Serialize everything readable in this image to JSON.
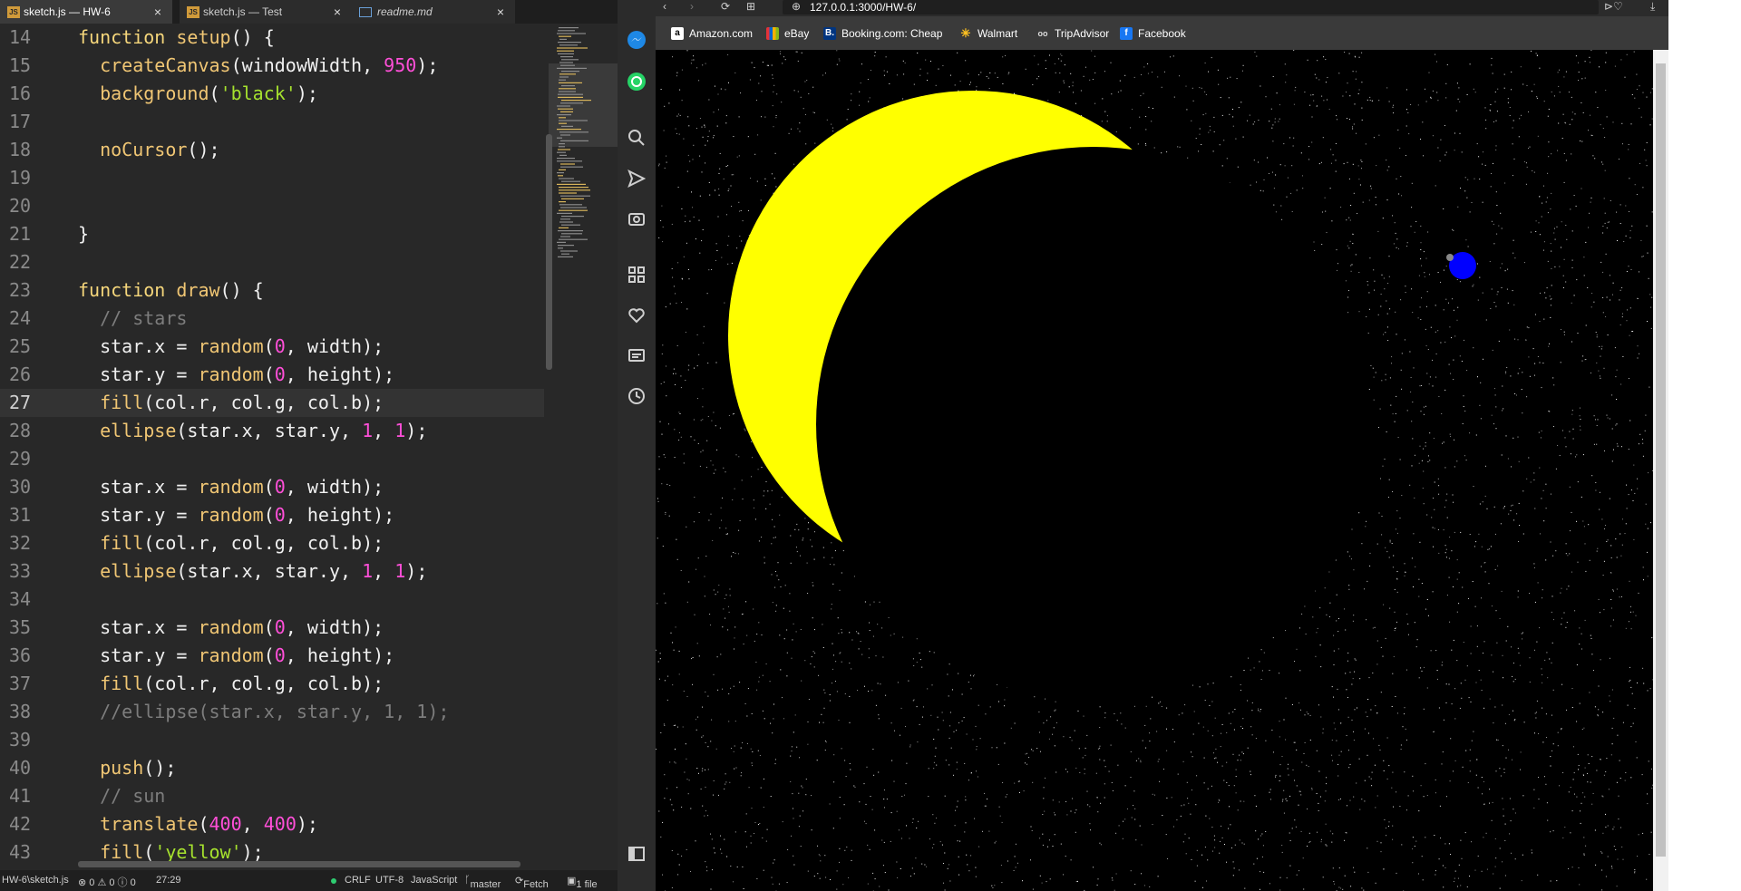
{
  "editor": {
    "tabs": [
      {
        "label": "sketch.js — HW-6",
        "badge": "JS",
        "active": true
      },
      {
        "label": "sketch.js — Test",
        "badge": "JS",
        "active": false
      },
      {
        "label": "readme.md",
        "badge": "",
        "active": false
      }
    ],
    "close_glyph": "×",
    "lines": [
      {
        "n": "14",
        "tokens": [
          [
            "kw",
            "function "
          ],
          [
            "fn",
            "setup"
          ],
          [
            "wt",
            "() {"
          ]
        ]
      },
      {
        "n": "15",
        "tokens": [
          [
            "wt",
            "  "
          ],
          [
            "fn",
            "createCanvas"
          ],
          [
            "wt",
            "(windowWidth, "
          ],
          [
            "num",
            "950"
          ],
          [
            "wt",
            ");"
          ]
        ]
      },
      {
        "n": "16",
        "tokens": [
          [
            "wt",
            "  "
          ],
          [
            "fn",
            "background"
          ],
          [
            "wt",
            "("
          ],
          [
            "str",
            "'black'"
          ],
          [
            "wt",
            ");"
          ]
        ]
      },
      {
        "n": "17",
        "tokens": []
      },
      {
        "n": "18",
        "tokens": [
          [
            "wt",
            "  "
          ],
          [
            "fn",
            "noCursor"
          ],
          [
            "wt",
            "();"
          ]
        ]
      },
      {
        "n": "19",
        "tokens": []
      },
      {
        "n": "20",
        "tokens": []
      },
      {
        "n": "21",
        "tokens": [
          [
            "wt",
            "}"
          ]
        ]
      },
      {
        "n": "22",
        "tokens": []
      },
      {
        "n": "23",
        "tokens": [
          [
            "kw",
            "function "
          ],
          [
            "fn",
            "draw"
          ],
          [
            "wt",
            "() {"
          ]
        ]
      },
      {
        "n": "24",
        "tokens": [
          [
            "cm",
            "  // stars"
          ]
        ]
      },
      {
        "n": "25",
        "tokens": [
          [
            "wt",
            "  star.x = "
          ],
          [
            "fn",
            "random"
          ],
          [
            "wt",
            "("
          ],
          [
            "num",
            "0"
          ],
          [
            "wt",
            ", width);"
          ]
        ]
      },
      {
        "n": "26",
        "tokens": [
          [
            "wt",
            "  star.y = "
          ],
          [
            "fn",
            "random"
          ],
          [
            "wt",
            "("
          ],
          [
            "num",
            "0"
          ],
          [
            "wt",
            ", height);"
          ]
        ]
      },
      {
        "n": "27",
        "tokens": [
          [
            "wt",
            "  "
          ],
          [
            "fn",
            "fill"
          ],
          [
            "wt",
            "(col.r, col.g, col.b);"
          ]
        ],
        "current": true
      },
      {
        "n": "28",
        "tokens": [
          [
            "wt",
            "  "
          ],
          [
            "fn",
            "ellipse"
          ],
          [
            "wt",
            "(star.x, star.y, "
          ],
          [
            "num",
            "1"
          ],
          [
            "wt",
            ", "
          ],
          [
            "num",
            "1"
          ],
          [
            "wt",
            ");"
          ]
        ]
      },
      {
        "n": "29",
        "tokens": []
      },
      {
        "n": "30",
        "tokens": [
          [
            "wt",
            "  star.x = "
          ],
          [
            "fn",
            "random"
          ],
          [
            "wt",
            "("
          ],
          [
            "num",
            "0"
          ],
          [
            "wt",
            ", width);"
          ]
        ]
      },
      {
        "n": "31",
        "tokens": [
          [
            "wt",
            "  star.y = "
          ],
          [
            "fn",
            "random"
          ],
          [
            "wt",
            "("
          ],
          [
            "num",
            "0"
          ],
          [
            "wt",
            ", height);"
          ]
        ]
      },
      {
        "n": "32",
        "tokens": [
          [
            "wt",
            "  "
          ],
          [
            "fn",
            "fill"
          ],
          [
            "wt",
            "(col.r, col.g, col.b);"
          ]
        ]
      },
      {
        "n": "33",
        "tokens": [
          [
            "wt",
            "  "
          ],
          [
            "fn",
            "ellipse"
          ],
          [
            "wt",
            "(star.x, star.y, "
          ],
          [
            "num",
            "1"
          ],
          [
            "wt",
            ", "
          ],
          [
            "num",
            "1"
          ],
          [
            "wt",
            ");"
          ]
        ]
      },
      {
        "n": "34",
        "tokens": []
      },
      {
        "n": "35",
        "tokens": [
          [
            "wt",
            "  star.x = "
          ],
          [
            "fn",
            "random"
          ],
          [
            "wt",
            "("
          ],
          [
            "num",
            "0"
          ],
          [
            "wt",
            ", width);"
          ]
        ]
      },
      {
        "n": "36",
        "tokens": [
          [
            "wt",
            "  star.y = "
          ],
          [
            "fn",
            "random"
          ],
          [
            "wt",
            "("
          ],
          [
            "num",
            "0"
          ],
          [
            "wt",
            ", height);"
          ]
        ]
      },
      {
        "n": "37",
        "tokens": [
          [
            "wt",
            "  "
          ],
          [
            "fn",
            "fill"
          ],
          [
            "wt",
            "(col.r, col.g, col.b);"
          ]
        ]
      },
      {
        "n": "38",
        "tokens": [
          [
            "cm",
            "  //ellipse(star.x, star.y, 1, 1);"
          ]
        ]
      },
      {
        "n": "39",
        "tokens": []
      },
      {
        "n": "40",
        "tokens": [
          [
            "wt",
            "  "
          ],
          [
            "fn",
            "push"
          ],
          [
            "wt",
            "();"
          ]
        ]
      },
      {
        "n": "41",
        "tokens": [
          [
            "cm",
            "  // sun"
          ]
        ]
      },
      {
        "n": "42",
        "tokens": [
          [
            "wt",
            "  "
          ],
          [
            "fn",
            "translate"
          ],
          [
            "wt",
            "("
          ],
          [
            "num",
            "400"
          ],
          [
            "wt",
            ", "
          ],
          [
            "num",
            "400"
          ],
          [
            "wt",
            ");"
          ]
        ]
      },
      {
        "n": "43",
        "tokens": [
          [
            "wt",
            "  "
          ],
          [
            "fn",
            "fill"
          ],
          [
            "wt",
            "("
          ],
          [
            "str",
            "'yellow'"
          ],
          [
            "wt",
            ");"
          ]
        ]
      }
    ],
    "status": {
      "path": "HW-6\\sketch.js",
      "counts": "⊗ 0 ⚠ 0 ⓘ 0",
      "cursor": "27:29",
      "eol": "CRLF",
      "encoding": "UTF-8",
      "language": "JavaScript",
      "branch": "master",
      "fetch": "Fetch",
      "files": "1 file"
    }
  },
  "browser": {
    "url": "127.0.0.1:3000/HW-6/",
    "bookmarks": [
      {
        "label": "Amazon.com",
        "icon": "a",
        "color": "#ffffff",
        "fg": "#000000"
      },
      {
        "label": "eBay",
        "icon": "",
        "color": "#e53238",
        "fg": "#ffffff"
      },
      {
        "label": "Booking.com: Cheap",
        "icon": "B.",
        "color": "#003580",
        "fg": "#ffffff"
      },
      {
        "label": "Walmart",
        "icon": "✳",
        "color": "#3a3a3a",
        "fg": "#ffc220"
      },
      {
        "label": "TripAdvisor",
        "icon": "oo",
        "color": "#3a3a3a",
        "fg": "#dddddd"
      },
      {
        "label": "Facebook",
        "icon": "f",
        "color": "#1877f2",
        "fg": "#ffffff"
      }
    ],
    "sidebar_icons": [
      "messenger-icon",
      "whatsapp-icon",
      "search-icon",
      "send-icon",
      "camera-icon",
      "apps-icon",
      "heart-icon",
      "reading-list-icon",
      "history-icon",
      "panel-icon"
    ],
    "canvas": {
      "background": "#000000",
      "sun_color": "#ffff00",
      "moon_color": "#000000",
      "planet_color": "#0000ff",
      "star_color": "#ffffff"
    }
  }
}
